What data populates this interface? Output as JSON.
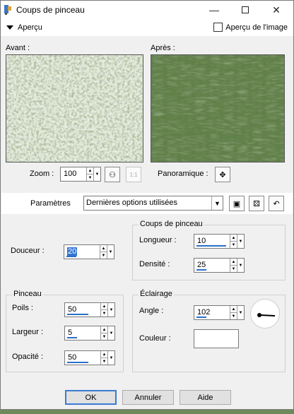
{
  "window": {
    "title": "Coups de pinceau"
  },
  "preview": {
    "toggle_label": "Aperçu",
    "image_preview_label": "Aperçu de l'image",
    "image_preview_checked": false
  },
  "panels": {
    "before_label": "Avant :",
    "after_label": "Après :"
  },
  "zoom": {
    "label": "Zoom :",
    "value": "100",
    "pan_label": "Panoramique :"
  },
  "params": {
    "label": "Paramètres",
    "preset": "Dernières options utilisées"
  },
  "softness": {
    "label": "Douceur :",
    "value": "20"
  },
  "strokes": {
    "title": "Coups de pinceau",
    "length_label": "Longueur :",
    "length_value": "10",
    "density_label": "Densité :",
    "density_value": "25"
  },
  "brush": {
    "title": "Pinceau",
    "bristles_label": "Poils :",
    "bristles_value": "50",
    "width_label": "Largeur :",
    "width_value": "5",
    "opacity_label": "Opacité :",
    "opacity_value": "50"
  },
  "lighting": {
    "title": "Éclairage",
    "angle_label": "Angle :",
    "angle_value": "102",
    "color_label": "Couleur :",
    "color": "#ffffff"
  },
  "buttons": {
    "ok": "OK",
    "cancel": "Annuler",
    "help": "Aide"
  },
  "icons": [
    "app-icon",
    "minimize-icon",
    "maximize-icon",
    "close-icon",
    "collapse-triangle-icon",
    "fit-zoom-icon",
    "actual-size-icon",
    "pan-move-icon",
    "save-preset-icon",
    "randomize-icon",
    "reset-icon",
    "angle-dial-icon"
  ],
  "colors": {
    "accent": "#3476d4",
    "texture_dark": "#4f6d3a",
    "texture_light": "#a9c28a"
  }
}
